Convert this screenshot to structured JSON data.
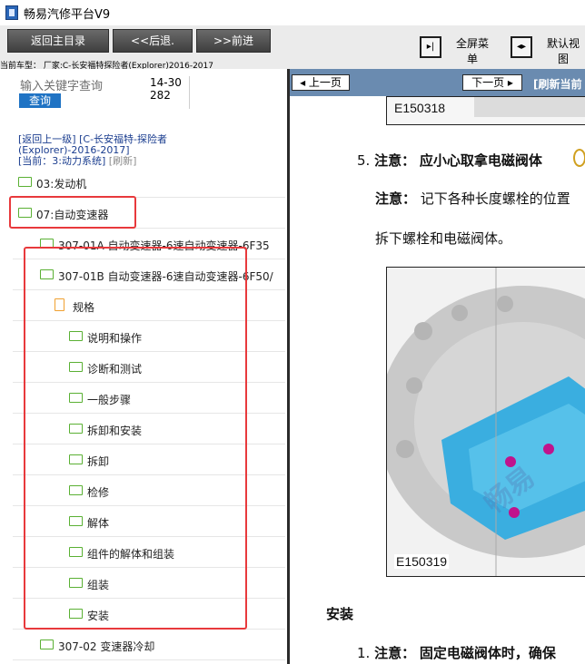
{
  "window": {
    "title": "畅易汽修平台V9"
  },
  "toolbar": {
    "back_main": "返回主目录",
    "back": "<<后退.",
    "forward": ">>前进",
    "fullscreen_label": "全屏菜单",
    "default_view_label": "默认视图"
  },
  "vehicle": {
    "text": "当前车型： 厂家:C-长安福特探险者(Explorer)2016-2017"
  },
  "search": {
    "placeholder": "输入关键字查询",
    "count": "14-30282",
    "query_btn": "查询"
  },
  "breadcrumb": {
    "back_up": "[返回上一级]",
    "path": "[C-长安福特-探险者(Explorer)-2016-2017]",
    "current": "[当前：3:动力系统]",
    "refresh": "[刷新]"
  },
  "tree": [
    {
      "label": "03:发动机",
      "icon": "folder-icon"
    },
    {
      "label": "07:自动变速器",
      "icon": "folder-icon"
    },
    {
      "label": "307-01A 自动变速器-6速自动变速器-6F35",
      "icon": "folder-icon"
    },
    {
      "label": "307-01B 自动变速器-6速自动变速器-6F50/",
      "icon": "folder-icon"
    },
    {
      "label": "规格",
      "icon": "document-icon"
    },
    {
      "label": "说明和操作",
      "icon": "folder-icon"
    },
    {
      "label": "诊断和测试",
      "icon": "folder-icon"
    },
    {
      "label": "一般步骤",
      "icon": "folder-icon"
    },
    {
      "label": "拆卸和安装",
      "icon": "folder-icon"
    },
    {
      "label": "拆卸",
      "icon": "folder-icon"
    },
    {
      "label": "检修",
      "icon": "folder-icon"
    },
    {
      "label": "解体",
      "icon": "folder-icon"
    },
    {
      "label": "组件的解体和组装",
      "icon": "folder-icon"
    },
    {
      "label": "组装",
      "icon": "folder-icon"
    },
    {
      "label": "安装",
      "icon": "folder-icon"
    },
    {
      "label": "307-02 变速器冷却",
      "icon": "folder-icon"
    }
  ],
  "nav": {
    "prev": "上一页",
    "next": "下一页",
    "refresh_current": "[刷新当前"
  },
  "doc": {
    "fig1_label": "E150318",
    "step5_num": "5.",
    "step5_note": "注意：",
    "step5_text": "应小心取拿电磁阀体",
    "note2_label": "注意：",
    "note2_text": "记下各种长度螺栓的位置",
    "remove_text": "拆下螺栓和电磁阀体。",
    "fig2_label": "E150319",
    "install_heading": "安装",
    "step1_num": "1.",
    "step1_note": "注意：",
    "step1_text": "固定电磁阀体时，确保",
    "watermark": "畅易"
  },
  "colors": {
    "accent_blue": "#1f73c4",
    "highlight_red": "#e8393c",
    "folder_green": "#5ab033",
    "nav_strip": "#6a8bb0"
  }
}
